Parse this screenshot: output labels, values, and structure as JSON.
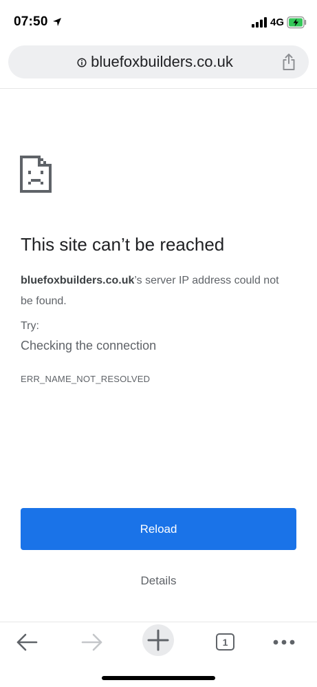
{
  "status_bar": {
    "time": "07:50",
    "network": "4G",
    "icons": [
      "location-arrow-icon",
      "cellular-signal-icon",
      "battery-charging-icon"
    ]
  },
  "url_bar": {
    "url": "bluefoxbuilders.co.uk",
    "icons": [
      "info-icon",
      "share-icon"
    ]
  },
  "error": {
    "icon": "sad-page-icon",
    "title": "This site can’t be reached",
    "domain": "bluefoxbuilders.co.uk",
    "description_rest": "’s server IP address could not be found.",
    "try_label": "Try:",
    "suggestion": "Checking the connection",
    "code": "ERR_NAME_NOT_RESOLVED"
  },
  "actions": {
    "reload_label": "Reload",
    "details_label": "Details"
  },
  "bottom_toolbar": {
    "tab_count": "1",
    "icons": [
      "back-arrow-icon",
      "forward-arrow-icon",
      "new-tab-plus-icon",
      "tab-switcher-icon",
      "more-menu-icon"
    ]
  },
  "colors": {
    "accent": "#1a73e8",
    "text_primary": "#202124",
    "text_secondary": "#5f6368",
    "url_bar_bg": "#eeeff1",
    "battery_charge": "#34c759"
  }
}
